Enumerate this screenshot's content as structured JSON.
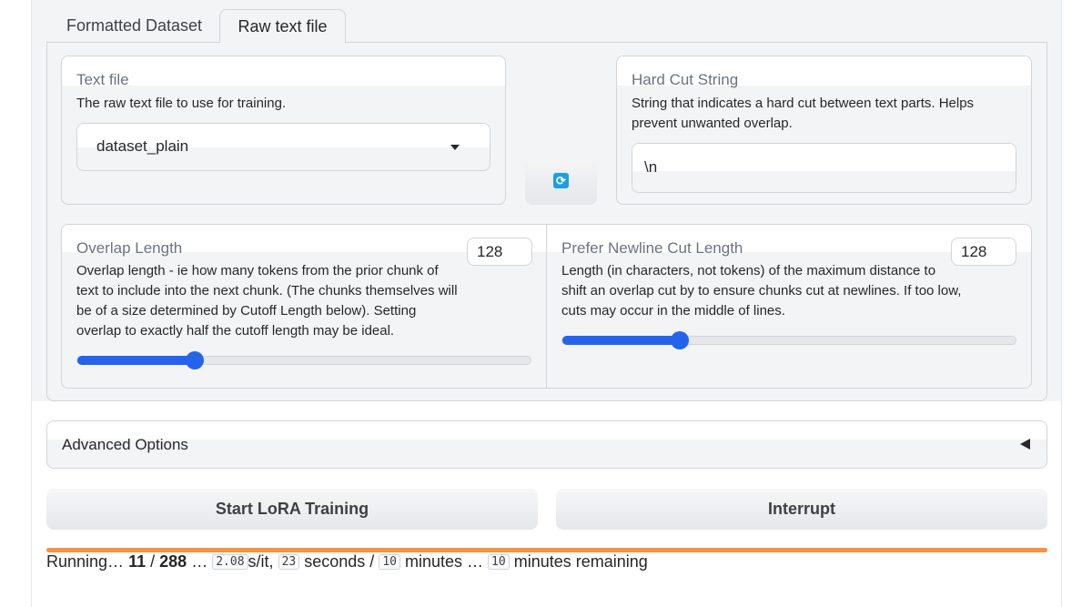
{
  "tabs": {
    "formatted_label": "Formatted Dataset",
    "raw_label": "Raw text file",
    "active": "Raw text file"
  },
  "text_file": {
    "title": "Text file",
    "description": "The raw text file to use for training.",
    "selected": "dataset_plain"
  },
  "hard_cut": {
    "title": "Hard Cut String",
    "description": "String that indicates a hard cut between text parts. Helps prevent unwanted overlap.",
    "value": "\\n"
  },
  "refresh": {
    "icon": "refresh-icon",
    "glyph": "⟳",
    "color": "#1ba1e2"
  },
  "overlap": {
    "title": "Overlap Length",
    "description": "Overlap length - ie how many tokens from the prior chunk of text to include into the next chunk. (The chunks themselves will be of a size determined by Cutoff Length below). Setting overlap to exactly half the cutoff length may be ideal.",
    "value": "128",
    "slider_fraction": 0.26
  },
  "newline_cut": {
    "title": "Prefer Newline Cut Length",
    "description": "Length (in characters, not tokens) of the maximum distance to shift an overlap cut by to ensure chunks cut at newlines. If too low, cuts may occur in the middle of lines.",
    "value": "128",
    "slider_fraction": 0.26
  },
  "advanced": {
    "label": "Advanced Options",
    "icon": "collapse-arrow-icon"
  },
  "buttons": {
    "start": "Start LoRA Training",
    "interrupt": "Interrupt"
  },
  "progress": {
    "fraction": 1.0,
    "prefix": "Running…",
    "current": "11",
    "sep": "/",
    "total": "288",
    "ellipsis1": "…",
    "rate": "2.08",
    "rate_unit": "s/it,",
    "elapsed": "23",
    "elapsed_unit": "seconds /",
    "total_time": "10",
    "total_unit": "minutes …",
    "remaining": "10",
    "remaining_unit": "minutes remaining"
  },
  "colors": {
    "accent": "#2563eb",
    "progress": "#fb923c"
  }
}
